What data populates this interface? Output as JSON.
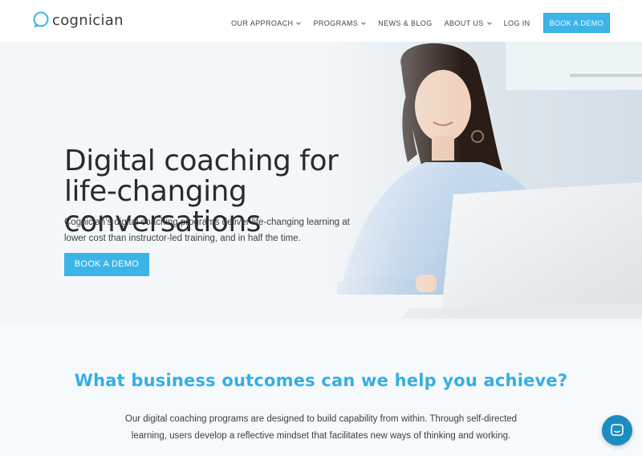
{
  "brand": {
    "name": "cognician",
    "accent": "#3cb4e8"
  },
  "nav": {
    "items": [
      {
        "label": "OUR APPROACH",
        "has_dropdown": true
      },
      {
        "label": "PROGRAMS",
        "has_dropdown": true
      },
      {
        "label": "NEWS & BLOG",
        "has_dropdown": false
      },
      {
        "label": "ABOUT US",
        "has_dropdown": true
      },
      {
        "label": "LOG IN",
        "has_dropdown": false
      }
    ],
    "cta_label": "BOOK A DEMO"
  },
  "hero": {
    "title": "Digital coaching for life-changing conversations",
    "subtitle": "Cognician’s digital coaching programs deliver life-changing learning at lower cost than instructor-led training, and in half the time.",
    "button_label": "BOOK A DEMO"
  },
  "outcomes": {
    "title": "What business outcomes can we help you achieve?",
    "text": "Our digital coaching programs are designed to build capability from within. Through self-directed learning, users develop a reflective mindset that facilitates new ways of thinking and working."
  },
  "chat": {
    "icon": "chat-bubble-icon",
    "color": "#1c8dbf"
  }
}
